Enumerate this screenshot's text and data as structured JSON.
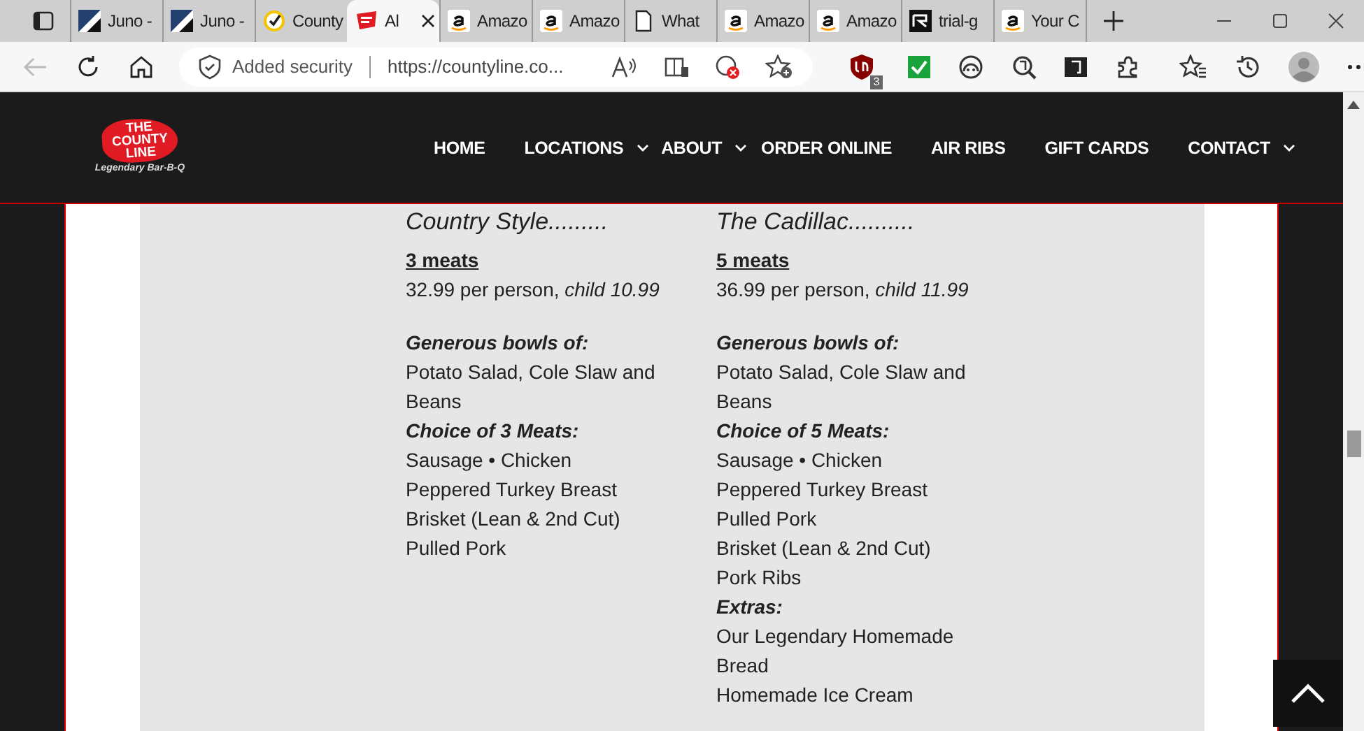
{
  "browser": {
    "tabs": [
      {
        "title": "Juno -",
        "kind": "juno",
        "selected": false
      },
      {
        "title": "Juno -",
        "kind": "juno",
        "selected": false
      },
      {
        "title": "County",
        "kind": "check",
        "selected": false
      },
      {
        "title": "Al",
        "kind": "countyline",
        "selected": true
      },
      {
        "title": "Amazo",
        "kind": "amazon",
        "selected": false
      },
      {
        "title": "Amazo",
        "kind": "amazon",
        "selected": false
      },
      {
        "title": "What",
        "kind": "page",
        "selected": false
      },
      {
        "title": "Amazo",
        "kind": "amazon",
        "selected": false
      },
      {
        "title": "Amazo",
        "kind": "amazon",
        "selected": false
      },
      {
        "title": "trial-g",
        "kind": "trial",
        "selected": false
      },
      {
        "title": "Your C",
        "kind": "amazon",
        "selected": false
      }
    ],
    "security": "Added security",
    "url": "https://countyline.co...",
    "extension_badge": "3"
  },
  "site": {
    "logo": {
      "lines": [
        "THE",
        "COUNTY",
        "LINE"
      ],
      "tagline": "Legendary Bar-B-Q"
    },
    "nav": [
      {
        "label": "HOME",
        "dropdown": false
      },
      {
        "label": "LOCATIONS",
        "dropdown": true
      },
      {
        "label": "ABOUT",
        "dropdown": true
      },
      {
        "label": "ORDER ONLINE",
        "dropdown": false
      },
      {
        "label": "AIR RIBS",
        "dropdown": false
      },
      {
        "label": "GIFT CARDS",
        "dropdown": false
      },
      {
        "label": "CONTACT",
        "dropdown": true
      }
    ]
  },
  "menu": [
    {
      "title": "Country Style.........",
      "meats": "3 meats",
      "price": "32.99 per person, *child 10.99*",
      "lines": [
        {
          "kind": "heading",
          "text": "Generous bowls of:"
        },
        {
          "kind": "item",
          "text": "Potato Salad, Cole Slaw and Beans"
        },
        {
          "kind": "heading",
          "text": "Choice of 3 Meats:"
        },
        {
          "kind": "item",
          "text": "Sausage • Chicken"
        },
        {
          "kind": "item",
          "text": "Peppered Turkey Breast"
        },
        {
          "kind": "item",
          "text": "Brisket (Lean & 2nd Cut)"
        },
        {
          "kind": "item",
          "text": "Pulled Pork"
        }
      ]
    },
    {
      "title": "The Cadillac..........",
      "meats": "5 meats",
      "price": "36.99 per person, *child 11.99*",
      "lines": [
        {
          "kind": "heading",
          "text": "Generous bowls of:"
        },
        {
          "kind": "item",
          "text": "Potato Salad, Cole Slaw and Beans"
        },
        {
          "kind": "heading",
          "text": "Choice of 5 Meats:"
        },
        {
          "kind": "item",
          "text": "Sausage • Chicken"
        },
        {
          "kind": "item",
          "text": "Peppered Turkey Breast"
        },
        {
          "kind": "item",
          "text": "Pulled Pork"
        },
        {
          "kind": "item",
          "text": "Brisket (Lean & 2nd Cut)"
        },
        {
          "kind": "item",
          "text": "Pork Ribs"
        },
        {
          "kind": "heading",
          "text": "Extras:"
        },
        {
          "kind": "item",
          "text": "Our Legendary Homemade Bread"
        },
        {
          "kind": "item",
          "text": "Homemade Ice Cream"
        }
      ]
    }
  ]
}
